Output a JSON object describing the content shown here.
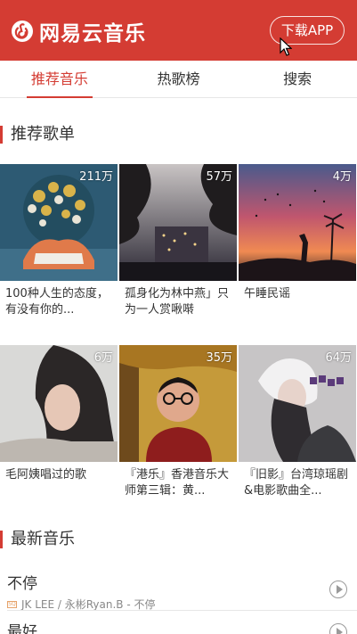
{
  "header": {
    "logo_text": "网易云音乐",
    "download_label": "下载APP"
  },
  "tabs": [
    {
      "label": "推荐音乐",
      "active": true
    },
    {
      "label": "热歌榜",
      "active": false
    },
    {
      "label": "搜索",
      "active": false
    }
  ],
  "recommended": {
    "title": "推荐歌单",
    "playlists": [
      {
        "count": "211万",
        "title": "100种人生的态度，有没有你的..."
      },
      {
        "count": "57万",
        "title": "孤身化为林中燕」只为一人赏啾啭"
      },
      {
        "count": "4万",
        "title": "午睡民谣"
      },
      {
        "count": "6万",
        "title": "毛阿姨唱过的歌"
      },
      {
        "count": "35万",
        "title": "『港乐』香港音乐大师第三辑：黄..."
      },
      {
        "count": "64万",
        "title": "『旧影』台湾琼瑶剧&电影歌曲全..."
      }
    ]
  },
  "latest": {
    "title": "最新音乐",
    "songs": [
      {
        "name": "不停",
        "meta": "JK LEE / 永彬Ryan.B - 不停",
        "badge": "SQ"
      },
      {
        "name": "最好",
        "meta": "",
        "badge": ""
      }
    ]
  },
  "colors": {
    "brand": "#d43c33",
    "divider": "#e6e6e6"
  }
}
